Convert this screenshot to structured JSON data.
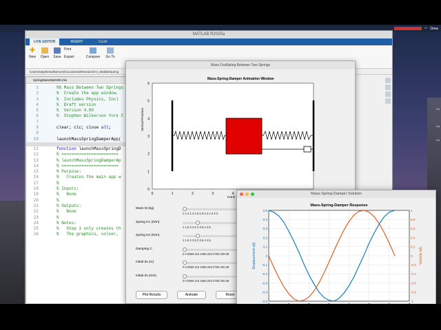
{
  "menubar": {
    "user": "Drew"
  },
  "desktop_icons": [
    "Fo",
    "Ca",
    "Co"
  ],
  "matlab": {
    "title": "MATLAB R2025a",
    "tabs": [
      "LIVE EDITOR",
      "INSERT",
      "VIEW"
    ],
    "ribbon": {
      "new": "New",
      "open": "Open",
      "save": "Save",
      "print": "Print",
      "export": "Export",
      "compare": "Compare",
      "goto": "Go To"
    },
    "path": "/Users/stephenwilkerson/Documents/Research/AI_Matlab/Spring",
    "editor_title": "Editor -",
    "doc_tab": "SpringMassStart400.mlx",
    "code_lines": [
      {
        "n": "1",
        "t": "%% Mass Between Two Springs",
        "c": "cm"
      },
      {
        "n": "2",
        "t": "%  Create the app window, ",
        "c": "cm"
      },
      {
        "n": "3",
        "t": "%  Includes Physics, Incl",
        "c": "cm"
      },
      {
        "n": "4",
        "t": "%  Draft version",
        "c": "cm"
      },
      {
        "n": "5",
        "t": "%  Version 4.00",
        "c": "cm"
      },
      {
        "n": "6",
        "t": "%  Stephen Wilkerson York C",
        "c": "cm"
      },
      {
        "n": "7",
        "t": "",
        "c": ""
      },
      {
        "n": "8",
        "t": "clear; clc; close all;",
        "c": "kwall"
      },
      {
        "n": "9",
        "t": "",
        "c": ""
      },
      {
        "n": "10",
        "t": "launchMassSpringDamperApp(",
        "c": ""
      },
      {
        "n": "",
        "t": "",
        "c": ""
      },
      {
        "n": "11",
        "t": "function launchMassSpringD",
        "c": "kwfn"
      },
      {
        "n": "12",
        "t": "% =======================",
        "c": "cm"
      },
      {
        "n": "13",
        "t": "% launchMassSpringDamperAp",
        "c": "cm"
      },
      {
        "n": "14",
        "t": "% =======================",
        "c": "cm"
      },
      {
        "n": "15",
        "t": "% Purpose:",
        "c": "cm"
      },
      {
        "n": "16",
        "t": "%   Creates the main app w",
        "c": "cm"
      },
      {
        "n": "17",
        "t": "%",
        "c": "cm"
      },
      {
        "n": "18",
        "t": "% Inputs:",
        "c": "cm"
      },
      {
        "n": "19",
        "t": "%   None",
        "c": "cm"
      },
      {
        "n": "20",
        "t": "%",
        "c": "cm"
      },
      {
        "n": "21",
        "t": "% Outputs:",
        "c": "cm"
      },
      {
        "n": "22",
        "t": "%   None",
        "c": "cm"
      },
      {
        "n": "23",
        "t": "%",
        "c": "cm"
      },
      {
        "n": "24",
        "t": "% Notes:",
        "c": "cm"
      },
      {
        "n": "25",
        "t": "%   Step 1 only creates th",
        "c": "cm"
      },
      {
        "n": "26",
        "t": "%   The graphics, solver, ",
        "c": "cm"
      }
    ]
  },
  "fig1": {
    "window_title": "Mass Oscillating Between Two Springs",
    "axes_title": "Mass-Spring-Damper Animation Window",
    "ylabel": "Vertical Position",
    "xlabel": "Horiz",
    "xticks": [
      "0",
      "1",
      "2",
      "3",
      "4",
      "5",
      "6",
      "7",
      "8"
    ],
    "yticks": [
      "0",
      "1",
      "2",
      "3",
      "4",
      "5",
      "6"
    ],
    "controls": [
      {
        "label": "Mass M (kg)",
        "ticks": "1  1.2  1.4  1.6  1.8  2  2.2  2.4  2.",
        "value": 0.0
      },
      {
        "label": "Spring K1 (N/m)",
        "ticks": "1   1.5   2   2.5   3   3.5   4   4.5",
        "value": 0.25
      },
      {
        "label": "Spring K2 (N/m)",
        "ticks": "1   1.5   2   2.5   3   3.5   4   4.5",
        "value": 0.25
      },
      {
        "label": "Damping C",
        "ticks": "0  0.0550.110.1650.220.2750.330.38",
        "value": 0.0
      },
      {
        "label": "Initial dx (m)",
        "ticks": "0  0.0550.110.1650.220.2750.330.38",
        "value": 0.0
      },
      {
        "label": "Initial dv (m/s)",
        "ticks": "0  0.0550.110.1650.220.2750.330.38",
        "value": 0.0
      }
    ],
    "buttons": [
      "Plot Results",
      "Animate",
      "Reset"
    ]
  },
  "fig2": {
    "window_title": "Mass-Spring-Damper Solution",
    "chart_data": {
      "type": "line",
      "title": "Mass-Spring-Damper Response",
      "xlabel": "Time (s)",
      "ylabel_left": "Displacement x(t)",
      "ylabel_right": "Velocity v(t)",
      "xlim": [
        0,
        7
      ],
      "ylim_left": [
        -0.5,
        0.5
      ],
      "ylim_right": [
        -1,
        1
      ],
      "xticks": [
        "0",
        "1",
        "2",
        "3",
        "4",
        "5",
        "6",
        "7"
      ],
      "yticks_left": [
        "-0.5",
        "-0.4",
        "-0.3",
        "-0.2",
        "-0.1",
        "0",
        "0.1",
        "0.2",
        "0.3",
        "0.4",
        "0.5"
      ],
      "yticks_right": [
        "-1",
        "-0.8",
        "-0.6",
        "-0.4",
        "-0.2",
        "0",
        "0.2",
        "0.4",
        "0.6",
        "0.8",
        "1"
      ],
      "grid": true,
      "series": [
        {
          "axis": "left",
          "color": "#0072BD",
          "x": [
            0,
            0.25,
            0.5,
            0.75,
            1,
            1.25,
            1.5,
            1.75,
            2,
            2.25,
            2.5,
            2.75,
            3,
            3.25,
            3.5,
            3.75,
            4,
            4.25,
            4.5,
            4.75,
            5,
            5.25,
            5.5,
            5.75,
            6,
            6.28
          ],
          "y": [
            0.5,
            0.48,
            0.44,
            0.37,
            0.27,
            0.16,
            0.04,
            -0.09,
            -0.21,
            -0.31,
            -0.4,
            -0.46,
            -0.49,
            -0.5,
            -0.47,
            -0.41,
            -0.33,
            -0.23,
            -0.11,
            0.01,
            0.14,
            0.25,
            0.35,
            0.43,
            0.48,
            0.5
          ]
        },
        {
          "axis": "right",
          "color": "#D95319",
          "x": [
            0,
            0.25,
            0.5,
            0.75,
            1,
            1.25,
            1.5,
            1.75,
            2,
            2.25,
            2.5,
            2.75,
            3,
            3.25,
            3.5,
            3.75,
            4,
            4.25,
            4.5,
            4.75,
            5,
            5.25,
            5.5,
            5.75,
            6,
            6.28
          ],
          "y": [
            0,
            -0.25,
            -0.48,
            -0.68,
            -0.84,
            -0.95,
            -1,
            -0.98,
            -0.91,
            -0.78,
            -0.6,
            -0.38,
            -0.14,
            0.11,
            0.35,
            0.57,
            0.76,
            0.9,
            0.98,
            1,
            0.96,
            0.86,
            0.71,
            0.51,
            0.28,
            0
          ]
        }
      ]
    }
  }
}
